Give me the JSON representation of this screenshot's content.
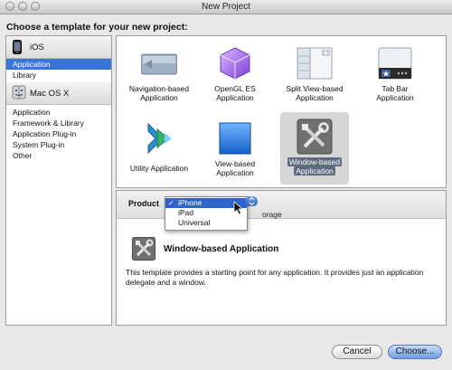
{
  "window": {
    "title": "New Project"
  },
  "heading": "Choose a template for your new project:",
  "sidebar": {
    "categories": [
      {
        "label": "iOS",
        "icon": "iphone-icon",
        "items": [
          {
            "label": "Application",
            "selected": true
          },
          {
            "label": "Library",
            "selected": false
          }
        ]
      },
      {
        "label": "Mac OS X",
        "icon": "mac-finder-icon",
        "items": [
          {
            "label": "Application",
            "selected": false
          },
          {
            "label": "Framework & Library",
            "selected": false
          },
          {
            "label": "Application Plug-in",
            "selected": false
          },
          {
            "label": "System Plug-in",
            "selected": false
          },
          {
            "label": "Other",
            "selected": false
          }
        ]
      }
    ]
  },
  "templates": [
    {
      "line1": "Navigation-based",
      "line2": "Application",
      "icon": "navigation-based-icon"
    },
    {
      "line1": "OpenGL ES",
      "line2": "Application",
      "icon": "opengl-cube-icon"
    },
    {
      "line1": "Split View-based",
      "line2": "Application",
      "icon": "split-view-icon"
    },
    {
      "line1": "Tab Bar",
      "line2": "Application",
      "icon": "tab-bar-icon"
    },
    {
      "line1": "Utility Application",
      "line2": "",
      "icon": "utility-arrows-icon"
    },
    {
      "line1": "View-based",
      "line2": "Application",
      "icon": "view-based-icon"
    },
    {
      "line1": "Window-based",
      "line2": "Application",
      "icon": "window-based-tools-icon",
      "selected": true
    }
  ],
  "product": {
    "label": "Product",
    "options": [
      "iPhone",
      "iPad",
      "Universal"
    ],
    "selected": "iPhone",
    "storage_fragment": "orage"
  },
  "detail": {
    "title": "Window-based Application",
    "description": "This template provides a starting point for any application. It provides just an application delegate and a window."
  },
  "buttons": {
    "cancel": "Cancel",
    "choose": "Choose..."
  },
  "colors": {
    "selection": "#3875d7",
    "menu_highlight": "#3162c9",
    "default_button": "#6e9ee0"
  }
}
